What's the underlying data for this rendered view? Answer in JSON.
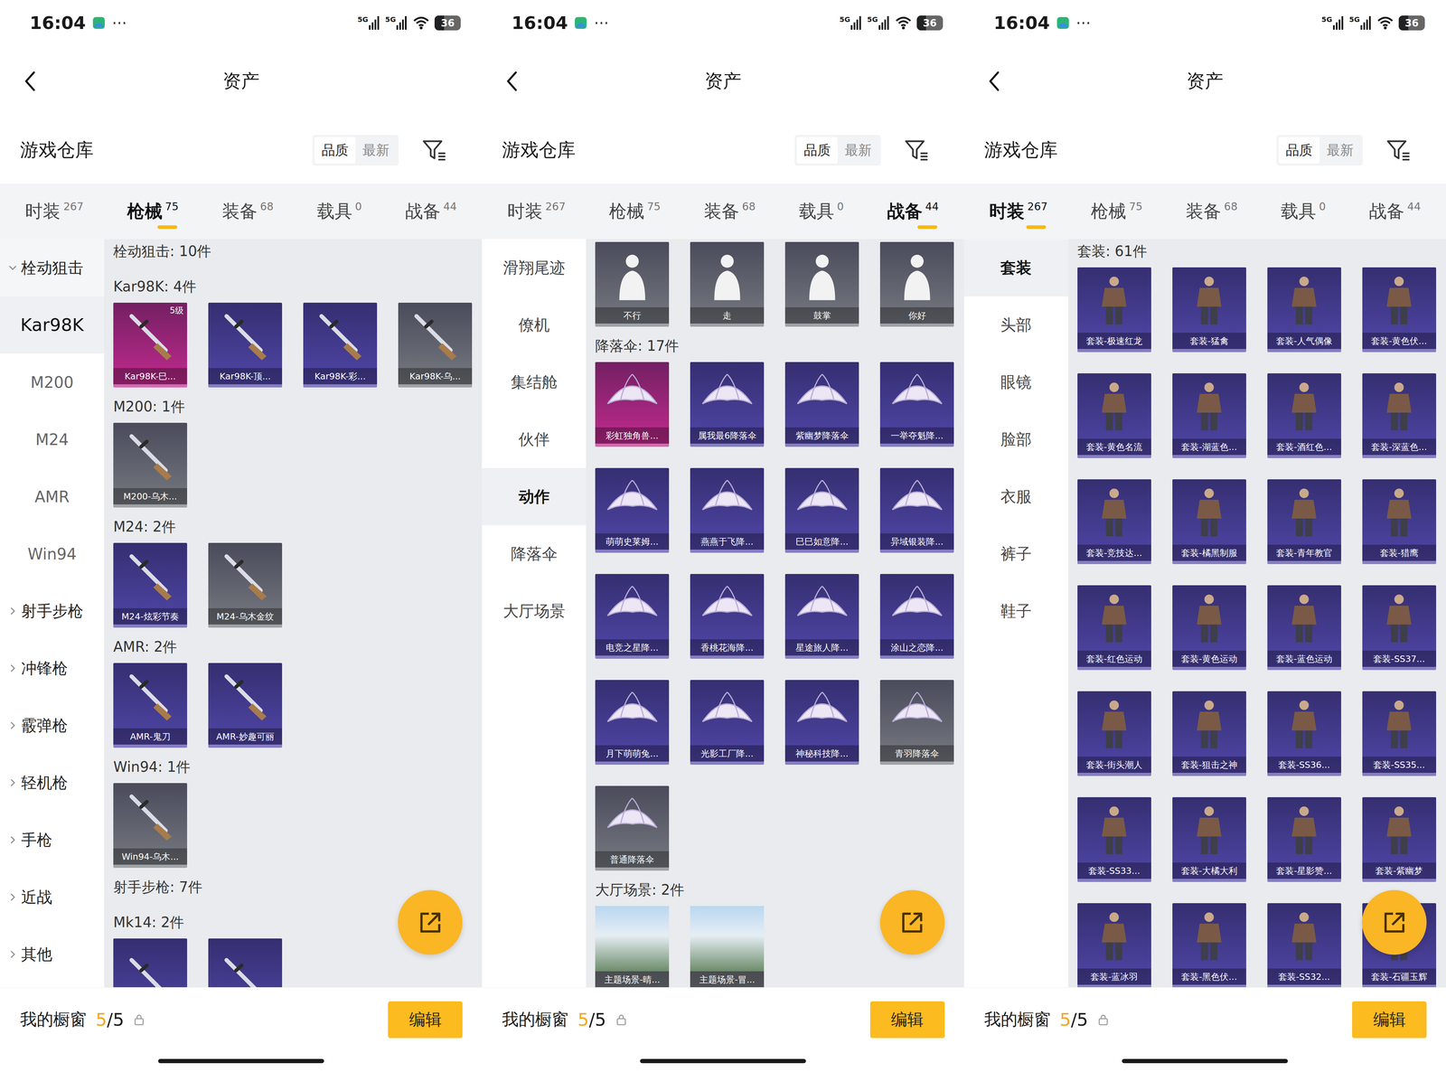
{
  "panels": [
    {
      "status_bar": {
        "time": "16:04",
        "more": "···",
        "networks": [
          "5G",
          "5G"
        ],
        "battery": "36",
        "battery_level": 0.36
      },
      "title": "资产",
      "warehouse": {
        "title": "游戏仓库",
        "sort": [
          {
            "label": "品质",
            "selected": true
          },
          {
            "label": "最新",
            "selected": false
          }
        ]
      },
      "tabs": [
        {
          "label": "时装",
          "count": "267",
          "selected": false
        },
        {
          "label": "枪械",
          "count": "75",
          "selected": true
        },
        {
          "label": "装备",
          "count": "68",
          "selected": false
        },
        {
          "label": "载具",
          "count": "0",
          "selected": false
        },
        {
          "label": "战备",
          "count": "44",
          "selected": false
        }
      ],
      "sidebar": [
        {
          "label": "栓动狙击",
          "kind": "group",
          "expanded": true,
          "selected": false
        },
        {
          "label": "Kar98K",
          "kind": "sub",
          "selected": true
        },
        {
          "label": "M200",
          "kind": "sub",
          "selected": false
        },
        {
          "label": "M24",
          "kind": "sub",
          "selected": false
        },
        {
          "label": "AMR",
          "kind": "sub",
          "selected": false
        },
        {
          "label": "Win94",
          "kind": "sub",
          "selected": false
        },
        {
          "label": "射手步枪",
          "kind": "group",
          "expanded": false,
          "selected": false
        },
        {
          "label": "冲锋枪",
          "kind": "group",
          "expanded": false,
          "selected": false
        },
        {
          "label": "霰弹枪",
          "kind": "group",
          "expanded": false,
          "selected": false
        },
        {
          "label": "轻机枪",
          "kind": "group",
          "expanded": false,
          "selected": false
        },
        {
          "label": "手枪",
          "kind": "group",
          "expanded": false,
          "selected": false
        },
        {
          "label": "近战",
          "kind": "group",
          "expanded": false,
          "selected": false
        },
        {
          "label": "其他",
          "kind": "group",
          "expanded": false,
          "selected": false
        }
      ],
      "sections": [
        {
          "title": "栓动狙击: 10件",
          "kind": "gun",
          "items": []
        },
        {
          "title": "Kar98K: 4件",
          "kind": "gun",
          "items": [
            {
              "name": "Kar98K-巳...",
              "color": "#c22a8e",
              "badge": "5级"
            },
            {
              "name": "Kar98K-顶...",
              "color": "#5046a8"
            },
            {
              "name": "Kar98K-彩...",
              "color": "#5046a8"
            },
            {
              "name": "Kar98K-乌...",
              "color": "#767a80"
            }
          ]
        },
        {
          "title": "M200: 1件",
          "kind": "gun",
          "items": [
            {
              "name": "M200-乌木...",
              "color": "#767a80"
            }
          ]
        },
        {
          "title": "M24: 2件",
          "kind": "gun",
          "items": [
            {
              "name": "M24-炫彩节奏",
              "color": "#5046a8"
            },
            {
              "name": "M24-乌木金纹",
              "color": "#767a80"
            }
          ]
        },
        {
          "title": "AMR: 2件",
          "kind": "gun",
          "items": [
            {
              "name": "AMR-鬼刀",
              "color": "#5046a8"
            },
            {
              "name": "AMR-妙趣可丽",
              "color": "#5046a8"
            }
          ]
        },
        {
          "title": "Win94: 1件",
          "kind": "gun",
          "items": [
            {
              "name": "Win94-乌木...",
              "color": "#767a80"
            }
          ]
        },
        {
          "title": "射手步枪: 7件",
          "kind": "gun",
          "items": []
        },
        {
          "title": "Mk14: 2件",
          "kind": "gun",
          "items": [
            {
              "color": "#5046a8"
            },
            {
              "color": "#5046a8"
            }
          ]
        }
      ],
      "showcase": {
        "label": "我的橱窗",
        "used": "5",
        "total": "/5",
        "button": "编辑"
      }
    },
    {
      "status_bar": {
        "time": "16:04",
        "more": "···",
        "networks": [
          "5G",
          "5G"
        ],
        "battery": "36",
        "battery_level": 0.36
      },
      "title": "资产",
      "warehouse": {
        "title": "游戏仓库",
        "sort": [
          {
            "label": "品质",
            "selected": true
          },
          {
            "label": "最新",
            "selected": false
          }
        ]
      },
      "tabs": [
        {
          "label": "时装",
          "count": "267",
          "selected": false
        },
        {
          "label": "枪械",
          "count": "75",
          "selected": false
        },
        {
          "label": "装备",
          "count": "68",
          "selected": false
        },
        {
          "label": "载具",
          "count": "0",
          "selected": false
        },
        {
          "label": "战备",
          "count": "44",
          "selected": true
        }
      ],
      "sidebar": [
        {
          "label": "滑翔尾迹",
          "kind": "item",
          "selected": false
        },
        {
          "label": "僚机",
          "kind": "item",
          "selected": false
        },
        {
          "label": "集结舱",
          "kind": "item",
          "selected": false
        },
        {
          "label": "伙伴",
          "kind": "item",
          "selected": false
        },
        {
          "label": "动作",
          "kind": "item",
          "selected": true
        },
        {
          "label": "降落伞",
          "kind": "item",
          "selected": false
        },
        {
          "label": "大厅场景",
          "kind": "item",
          "selected": false
        }
      ],
      "sections": [
        {
          "kind": "gesture",
          "items": [
            {
              "name": "不行",
              "color": "#767a80"
            },
            {
              "name": "走",
              "color": "#767a80"
            },
            {
              "name": "鼓掌",
              "color": "#767a80"
            },
            {
              "name": "你好",
              "color": "#767a80"
            }
          ]
        },
        {
          "title": "降落伞: 17件",
          "kind": "parachute",
          "items": [
            {
              "name": "彩虹独角兽...",
              "color": "#c22a8e"
            },
            {
              "name": "属我最6降落伞",
              "color": "#5046a8"
            },
            {
              "name": "紫幽梦降落伞",
              "color": "#5046a8"
            },
            {
              "name": "一举夺魁降...",
              "color": "#5046a8"
            },
            {
              "name": "萌萌史莱姆...",
              "color": "#5046a8"
            },
            {
              "name": "燕燕于飞降...",
              "color": "#5046a8"
            },
            {
              "name": "巳巳如意降...",
              "color": "#5046a8"
            },
            {
              "name": "异域银装降...",
              "color": "#5046a8"
            },
            {
              "name": "电竞之星降...",
              "color": "#5046a8"
            },
            {
              "name": "香桃花海降...",
              "color": "#5046a8"
            },
            {
              "name": "星途旅人降...",
              "color": "#5046a8"
            },
            {
              "name": "涂山之恋降...",
              "color": "#5046a8"
            },
            {
              "name": "月下萌萌兔...",
              "color": "#5046a8"
            },
            {
              "name": "光影工厂降...",
              "color": "#5046a8"
            },
            {
              "name": "神秘科技降...",
              "color": "#5046a8"
            },
            {
              "name": "青羽降落伞",
              "color": "#767a80"
            },
            {
              "name": "普通降落伞",
              "color": "#767a80"
            }
          ]
        },
        {
          "title": "大厅场景: 2件",
          "kind": "scene",
          "items": [
            {
              "name": "主题场景-晴...",
              "color": "#767a80"
            },
            {
              "name": "主题场景-冒...",
              "color": "#767a80"
            }
          ]
        }
      ],
      "showcase": {
        "label": "我的橱窗",
        "used": "5",
        "total": "/5",
        "button": "编辑"
      }
    },
    {
      "status_bar": {
        "time": "16:04",
        "more": "···",
        "networks": [
          "5G",
          "5G"
        ],
        "battery": "36",
        "battery_level": 0.36
      },
      "title": "资产",
      "warehouse": {
        "title": "游戏仓库",
        "sort": [
          {
            "label": "品质",
            "selected": true
          },
          {
            "label": "最新",
            "selected": false
          }
        ]
      },
      "tabs": [
        {
          "label": "时装",
          "count": "267",
          "selected": true
        },
        {
          "label": "枪械",
          "count": "75",
          "selected": false
        },
        {
          "label": "装备",
          "count": "68",
          "selected": false
        },
        {
          "label": "载具",
          "count": "0",
          "selected": false
        },
        {
          "label": "战备",
          "count": "44",
          "selected": false
        }
      ],
      "sidebar": [
        {
          "label": "套装",
          "kind": "item",
          "selected": true
        },
        {
          "label": "头部",
          "kind": "item",
          "selected": false
        },
        {
          "label": "眼镜",
          "kind": "item",
          "selected": false
        },
        {
          "label": "脸部",
          "kind": "item",
          "selected": false
        },
        {
          "label": "衣服",
          "kind": "item",
          "selected": false
        },
        {
          "label": "裤子",
          "kind": "item",
          "selected": false
        },
        {
          "label": "鞋子",
          "kind": "item",
          "selected": false
        }
      ],
      "sections": [
        {
          "title": "套装: 61件",
          "kind": "outfit",
          "items": [
            {
              "name": "套装-极速红龙",
              "color": "#5046a8"
            },
            {
              "name": "套装-猛禽",
              "color": "#5046a8"
            },
            {
              "name": "套装-人气偶像",
              "color": "#5046a8"
            },
            {
              "name": "套装-黄色伏...",
              "color": "#5046a8"
            },
            {
              "name": "套装-黄色名流",
              "color": "#5046a8"
            },
            {
              "name": "套装-湖蓝色...",
              "color": "#5046a8"
            },
            {
              "name": "套装-酒红色...",
              "color": "#5046a8"
            },
            {
              "name": "套装-深蓝色...",
              "color": "#5046a8"
            },
            {
              "name": "套装-竞技达...",
              "color": "#5046a8"
            },
            {
              "name": "套装-橘黑制服",
              "color": "#5046a8"
            },
            {
              "name": "套装-青年教官",
              "color": "#5046a8"
            },
            {
              "name": "套装-猎鹰",
              "color": "#5046a8"
            },
            {
              "name": "套装-红色运动",
              "color": "#5046a8"
            },
            {
              "name": "套装-黄色运动",
              "color": "#5046a8"
            },
            {
              "name": "套装-蓝色运动",
              "color": "#5046a8"
            },
            {
              "name": "套装-SS37...",
              "color": "#5046a8"
            },
            {
              "name": "套装-街头潮人",
              "color": "#5046a8"
            },
            {
              "name": "套装-狙击之神",
              "color": "#5046a8"
            },
            {
              "name": "套装-SS36...",
              "color": "#5046a8"
            },
            {
              "name": "套装-SS35...",
              "color": "#5046a8"
            },
            {
              "name": "套装-SS33...",
              "color": "#5046a8"
            },
            {
              "name": "套装-大橘大利",
              "color": "#5046a8"
            },
            {
              "name": "套装-星影赞...",
              "color": "#5046a8"
            },
            {
              "name": "套装-紫幽梦",
              "color": "#5046a8"
            },
            {
              "name": "套装-蓝冰羽",
              "color": "#5046a8"
            },
            {
              "name": "套装-黑色伏...",
              "color": "#5046a8"
            },
            {
              "name": "套装-SS32...",
              "color": "#5046a8"
            },
            {
              "name": "套装-石疆玉辉",
              "color": "#5046a8"
            }
          ]
        }
      ],
      "showcase": {
        "label": "我的橱窗",
        "used": "5",
        "total": "/5",
        "button": "编辑"
      }
    }
  ]
}
